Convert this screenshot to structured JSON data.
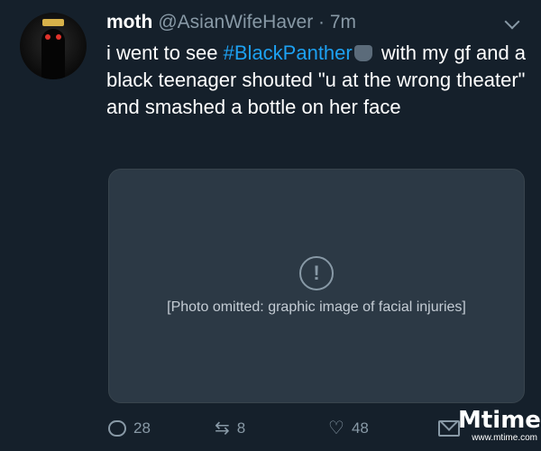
{
  "tweet": {
    "display_name": "moth",
    "handle": "@AsianWifeHaver · 7m",
    "text_before": "i went to see ",
    "hashtag": "#BlackPanther",
    "text_after": " with my gf and a black teenager shouted \"u at the wrong theater\" and smashed a bottle on her face",
    "hashtag_emoji_icon": "panther-emoji-icon",
    "media_notice": "[Photo omitted: graphic image of facial injuries]"
  },
  "actions": {
    "reply_count": "28",
    "retweet_count": "8",
    "like_count": "48",
    "icons": [
      "reply-icon",
      "retweet-icon",
      "heart-icon",
      "message-icon"
    ]
  },
  "watermark": {
    "logo": "Mtime",
    "url": "www.mtime.com"
  },
  "colors": {
    "background": "#15202b",
    "hashtag": "#1da1f2",
    "muted": "#8899a6"
  }
}
